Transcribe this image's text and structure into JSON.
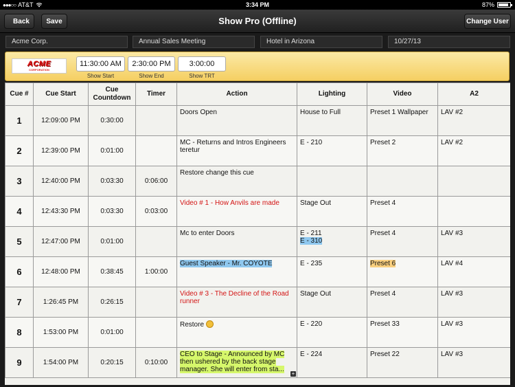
{
  "status_bar": {
    "carrier": "AT&T",
    "time": "3:34 PM",
    "battery": "87%",
    "battery_level": 0.87
  },
  "nav": {
    "title": "Show Pro (Offline)",
    "back_label": "Back",
    "save_label": "Save",
    "change_user_label": "Change User"
  },
  "info": {
    "client": "Acme Corp.",
    "event": "Annual Sales Meeting",
    "venue": "Hotel in  Arizona",
    "date": "10/27/13"
  },
  "banner": {
    "logo_text": "ACME",
    "logo_sub": "CORPORATION",
    "show_start": "11:30:00 AM",
    "show_start_label": "Show Start",
    "show_end": "2:30:00 PM",
    "show_end_label": "Show End",
    "show_trt": "3:00:00",
    "show_trt_label": "Show TRT"
  },
  "table": {
    "headers": {
      "cue": "Cue #",
      "start": "Cue Start",
      "countdown": "Cue Countdown",
      "timer": "Timer",
      "action": "Action",
      "lighting": "Lighting",
      "video": "Video",
      "a2": "A2"
    },
    "rows": [
      {
        "cue": "1",
        "start": "12:09:00 PM",
        "countdown": "0:30:00",
        "timer": "",
        "action": "Doors Open",
        "lighting": "House to Full",
        "lighting2": "",
        "video": "Preset 1 Wallpaper",
        "a2": "LAV #2"
      },
      {
        "cue": "2",
        "start": "12:39:00 PM",
        "countdown": "0:01:00",
        "timer": "",
        "action": "MC - Returns and Intros Engineers teretur",
        "lighting": "E - 210",
        "lighting2": "",
        "video": "Preset 2",
        "a2": "LAV #2"
      },
      {
        "cue": "3",
        "start": "12:40:00 PM",
        "countdown": "0:03:30",
        "timer": "0:06:00",
        "action": "Restore change this cue",
        "lighting": "",
        "lighting2": "",
        "video": "",
        "a2": ""
      },
      {
        "cue": "4",
        "start": "12:43:30 PM",
        "countdown": "0:03:30",
        "timer": "0:03:00",
        "action": "Video # 1 - How Anvils are made",
        "lighting": "Stage Out",
        "lighting2": "",
        "video": "Preset 4",
        "a2": ""
      },
      {
        "cue": "5",
        "start": "12:47:00 PM",
        "countdown": "0:01:00",
        "timer": "",
        "action": "Mc to enter Doors",
        "lighting": "E - 211",
        "lighting2": "E - 310",
        "video": "Preset 4",
        "a2": "LAV #3"
      },
      {
        "cue": "6",
        "start": "12:48:00 PM",
        "countdown": "0:38:45",
        "timer": "1:00:00",
        "action": "Guest Speaker - Mr. COYOTE",
        "lighting": "E - 235",
        "lighting2": "",
        "video": "Preset 6",
        "a2": "LAV #4"
      },
      {
        "cue": "7",
        "start": "1:26:45 PM",
        "countdown": "0:26:15",
        "timer": "",
        "action": "Video # 3 - The Decline of the Road runner",
        "lighting": "Stage Out",
        "lighting2": "",
        "video": "Preset 4",
        "a2": "LAV #3"
      },
      {
        "cue": "8",
        "start": "1:53:00 PM",
        "countdown": "0:01:00",
        "timer": "",
        "action": "Restore",
        "lighting": "E - 220",
        "lighting2": "",
        "video": "Preset 33",
        "a2": "LAV #3"
      },
      {
        "cue": "9",
        "start": "1:54:00 PM",
        "countdown": "0:20:15",
        "timer": "0:10:00",
        "action": "CEO to Stage - Announced by MC then ushered by the back stage manager. She will enter from sta...",
        "lighting": "E - 224",
        "lighting2": "",
        "video": "Preset 22",
        "a2": "LAV #3"
      }
    ]
  },
  "colors": {
    "highlight_blue": "#8fc8ef",
    "highlight_orange": "#f9cf7e",
    "highlight_green": "#d6f76b",
    "red_text": "#d31414",
    "banner_yellow": "#f5cf62"
  }
}
